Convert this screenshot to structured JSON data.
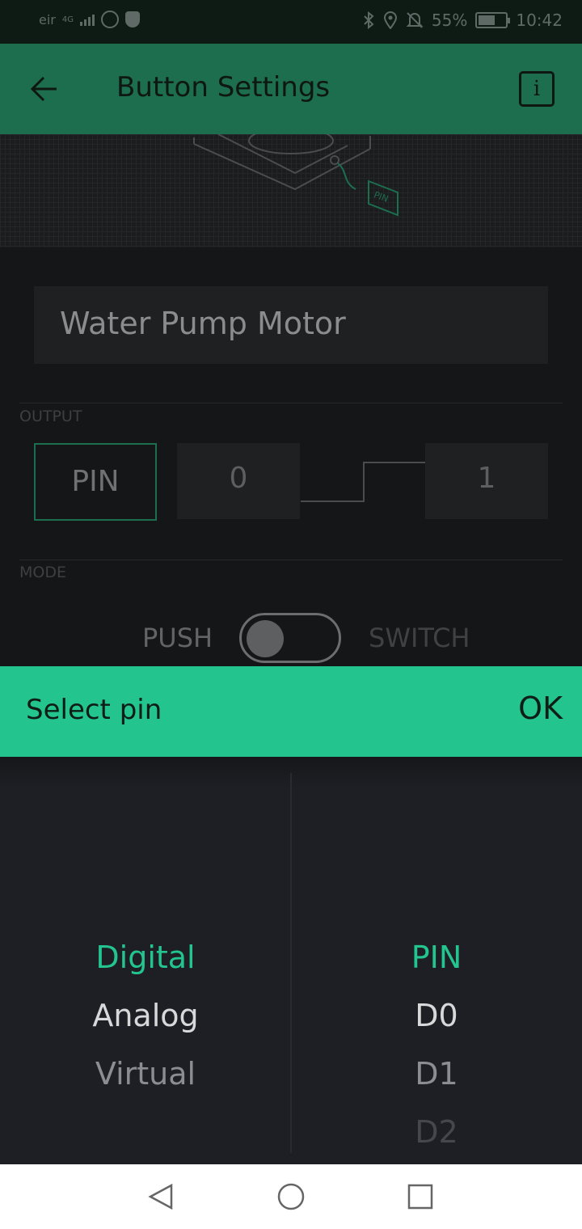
{
  "status_bar": {
    "carrier": "eir",
    "network": "4G",
    "battery": "55%",
    "time": "10:42"
  },
  "app_bar": {
    "title": "Button Settings",
    "info_glyph": "i"
  },
  "hero": {
    "pin_tag": "PIN"
  },
  "widget": {
    "name": "Water Pump Motor",
    "output_label": "OUTPUT",
    "pin_label": "PIN",
    "low_value": "0",
    "high_value": "1",
    "mode_label": "MODE",
    "mode_push": "PUSH",
    "mode_switch": "SWITCH"
  },
  "select_pin": {
    "title": "Select pin",
    "ok": "OK"
  },
  "picker": {
    "types": [
      "Digital",
      "Analog",
      "Virtual"
    ],
    "pins": [
      "PIN",
      "D0",
      "D1",
      "D2"
    ]
  },
  "colors": {
    "accent": "#23c48e",
    "app_bar": "#1c6e4f",
    "background": "#1e1f24"
  }
}
